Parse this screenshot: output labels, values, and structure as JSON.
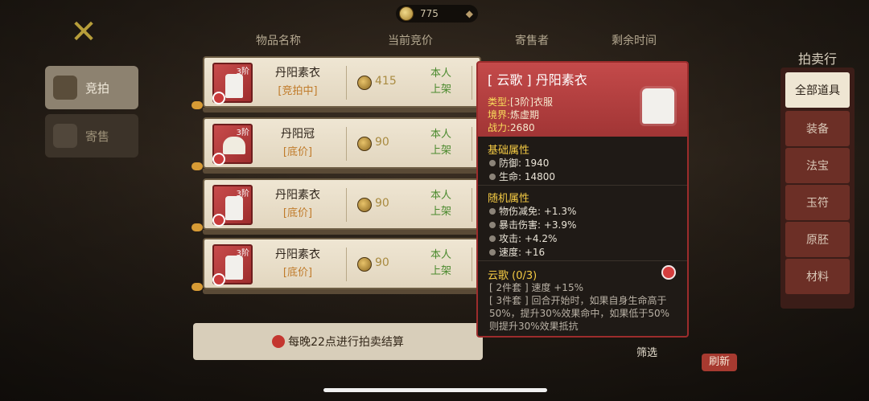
{
  "currency": {
    "amount": "775",
    "icon": "coin-icon",
    "add_icon": "plus-diamond-icon"
  },
  "left_tabs": [
    {
      "label": "竞拍",
      "icon": "auction-hammer-icon",
      "active": true
    },
    {
      "label": "寄售",
      "icon": "consign-bag-icon",
      "active": false
    }
  ],
  "headers": {
    "item_name": "物品名称",
    "current_bid": "当前竞价",
    "seller": "寄售者",
    "time_left": "剩余时间"
  },
  "rows": [
    {
      "tier": "3阶",
      "name": "丹阳素衣",
      "status": "[竞拍中]",
      "price": "415",
      "seller": "本人上架"
    },
    {
      "tier": "3阶",
      "name": "丹阳冠",
      "status": "[底价]",
      "price": "90",
      "seller": "本人上架"
    },
    {
      "tier": "3阶",
      "name": "丹阳素衣",
      "status": "[底价]",
      "price": "90",
      "seller": "本人上架"
    },
    {
      "tier": "3阶",
      "name": "丹阳素衣",
      "status": "[底价]",
      "price": "90",
      "seller": "本人上架"
    }
  ],
  "notice": {
    "text": "每晚22点进行拍卖结算"
  },
  "tooltip": {
    "title": "[ 云歌 ] 丹阳素衣",
    "type_label": "类型:",
    "type_value": "[3阶]衣服",
    "realm_label": "境界:",
    "realm_value": "炼虚期",
    "power_label": "战力:",
    "power_value": "2680",
    "base_title": "基础属性",
    "base_stats": [
      "防御: 1940",
      "生命: 14800"
    ],
    "random_title": "随机属性",
    "random_stats": [
      "物伤减免: +1.3%",
      "暴击伤害: +3.9%",
      "攻击: +4.2%",
      "速度: +16"
    ],
    "set_title": "云歌 (0/3)",
    "set_2": "[ 2件套 ] 速度 +15%",
    "set_3": "[ 3件套 ] 回合开始时，如果自身生命高于50%，提升30%效果命中，如果低于50%则提升30%效果抵抗"
  },
  "right_panel": {
    "title": "拍卖行",
    "categories": [
      "全部道具",
      "装备",
      "法宝",
      "玉符",
      "原胚",
      "材料"
    ],
    "selected": "全部道具"
  },
  "filter_label": "筛选",
  "refresh_label": "刷新"
}
